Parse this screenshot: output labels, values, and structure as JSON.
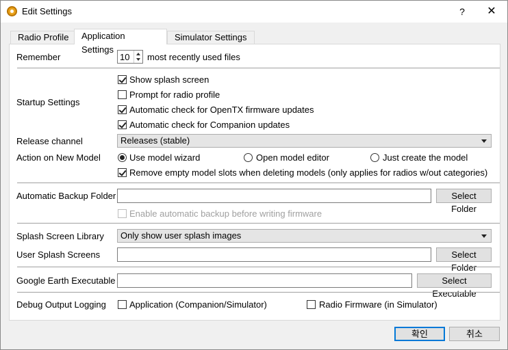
{
  "window": {
    "title": "Edit Settings",
    "help": "?",
    "close": "✕"
  },
  "tabs": [
    {
      "label": "Radio Profile",
      "active": false
    },
    {
      "label": "Application Settings",
      "active": true
    },
    {
      "label": "Simulator Settings",
      "active": false
    }
  ],
  "remember": {
    "label": "Remember",
    "value": "10",
    "suffix": "most recently used files"
  },
  "startup": {
    "label": "Startup Settings",
    "options": [
      {
        "label": "Show splash screen",
        "checked": true
      },
      {
        "label": "Prompt for radio profile",
        "checked": false
      },
      {
        "label": "Automatic check for OpenTX firmware updates",
        "checked": true
      },
      {
        "label": "Automatic check for Companion updates",
        "checked": true
      }
    ]
  },
  "release_channel": {
    "label": "Release channel",
    "value": "Releases (stable)"
  },
  "new_model": {
    "label": "Action on New Model",
    "options": [
      {
        "label": "Use model wizard",
        "selected": true
      },
      {
        "label": "Open model editor",
        "selected": false
      },
      {
        "label": "Just create the model",
        "selected": false
      }
    ],
    "remove_empty": {
      "label": "Remove empty model slots when deleting models (only applies for radios w/out categories)",
      "checked": true
    }
  },
  "backup": {
    "label": "Automatic Backup Folder",
    "value": "",
    "button": "Select Folder",
    "enable_label": "Enable automatic backup before writing firmware",
    "enable_checked": false
  },
  "splash_library": {
    "label": "Splash Screen Library",
    "value": "Only show user splash images"
  },
  "user_splash": {
    "label": "User Splash Screens",
    "value": "",
    "button": "Select Folder"
  },
  "google_earth": {
    "label": "Google Earth Executable",
    "value": "",
    "button": "Select Executable"
  },
  "debug": {
    "label": "Debug Output Logging",
    "options": [
      {
        "label": "Application (Companion/Simulator)",
        "checked": false
      },
      {
        "label": "Radio Firmware (in Simulator)",
        "checked": false
      }
    ]
  },
  "footer": {
    "ok": "확인",
    "cancel": "취소"
  },
  "colors": {
    "accent": "#0078d7",
    "window_bg": "#f0f0f0",
    "panel_bg": "#ffffff"
  }
}
